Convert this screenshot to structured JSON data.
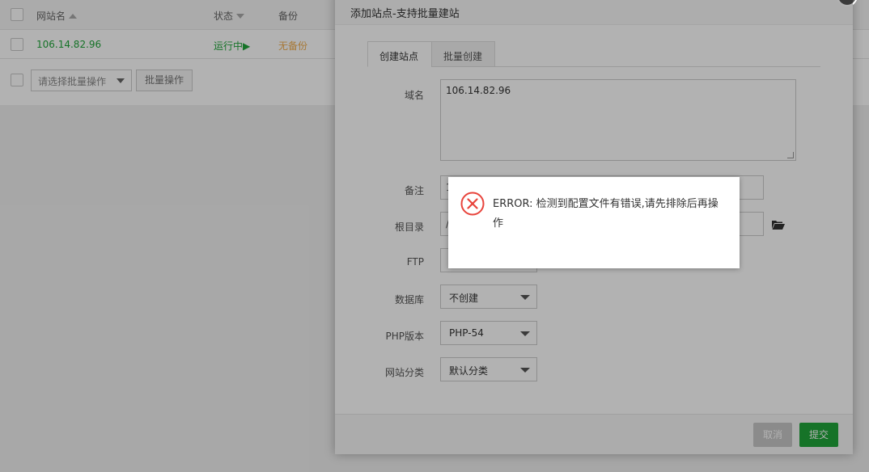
{
  "table": {
    "col_name": "网站名",
    "col_status": "状态",
    "col_backup": "备份",
    "row": {
      "name": "106.14.82.96",
      "status": "运行中▶",
      "backup": "无备份"
    },
    "bulk_select_placeholder": "请选择批量操作",
    "bulk_button": "批量操作"
  },
  "dialog": {
    "title": "添加站点-支持批量建站",
    "close": "×",
    "tabs": [
      {
        "label": "创建站点"
      },
      {
        "label": "批量创建"
      }
    ],
    "domain_label": "域名",
    "domain_value": "106.14.82.96",
    "note_label": "备注",
    "note_value": "1",
    "root_label": "根目录",
    "root_value": "/",
    "ftp_label": "FTP",
    "db_label": "数据库",
    "db_value": "不创建",
    "php_label": "PHP版本",
    "php_value": "PHP-54",
    "category_label": "网站分类",
    "category_value": "默认分类",
    "cancel": "取消",
    "submit": "提交"
  },
  "error": {
    "message": "ERROR: 检测到配置文件有错误,请先排除后再操作"
  },
  "colors": {
    "accent": "#20a53a",
    "error": "#e8443c",
    "warning": "#f0ad4e"
  }
}
